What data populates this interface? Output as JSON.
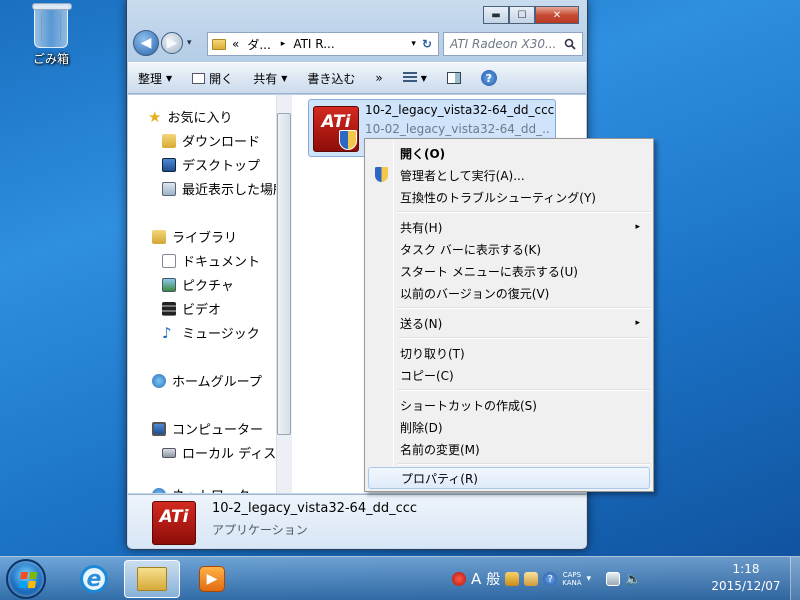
{
  "desktop": {
    "recycle_bin_label": "ごみ箱"
  },
  "window": {
    "title_buttons": {
      "minimize": "▬",
      "maximize": "☐",
      "close": "✕"
    },
    "breadcrumb": {
      "chevrons": "«",
      "segment1": "ダ...",
      "separator": "▸",
      "segment2": "ATI R...",
      "dropdown": "▾",
      "refresh": "↻"
    },
    "search_placeholder": "ATI Radeon X30...",
    "back_glyph": "◀",
    "forward_glyph": "▶",
    "toolbar": {
      "organize": "整理",
      "open": "開く",
      "share": "共有",
      "burn": "書き込む",
      "more": "»"
    },
    "nav": {
      "favorites": "お気に入り",
      "downloads": "ダウンロード",
      "desktop": "デスクトップ",
      "recent": "最近表示した場所",
      "libraries": "ライブラリ",
      "documents": "ドキュメント",
      "pictures": "ピクチャ",
      "videos": "ビデオ",
      "music": "ミュージック",
      "homegroup": "ホームグループ",
      "computer": "コンピューター",
      "local_disk": "ローカル ディスク",
      "network_partial": "ネットワーク"
    },
    "file": {
      "name": "10-2_legacy_vista32-64_dd_ccc",
      "description": "10-02_legacy_vista32-64_dd_...",
      "logo_text": "ATi"
    },
    "details": {
      "name": "10-2_legacy_vista32-64_dd_ccc",
      "type": "アプリケーション"
    }
  },
  "context_menu": {
    "items": [
      {
        "label": "開く(O)"
      },
      {
        "label": "管理者として実行(A)..."
      },
      {
        "label": "互換性のトラブルシューティング(Y)"
      },
      {
        "label": "共有(H)"
      },
      {
        "label": "タスク バーに表示する(K)"
      },
      {
        "label": "スタート メニューに表示する(U)"
      },
      {
        "label": "以前のバージョンの復元(V)"
      },
      {
        "label": "送る(N)"
      },
      {
        "label": "切り取り(T)"
      },
      {
        "label": "コピー(C)"
      },
      {
        "label": "ショートカットの作成(S)"
      },
      {
        "label": "削除(D)"
      },
      {
        "label": "名前の変更(M)"
      },
      {
        "label": "プロパティ(R)"
      }
    ],
    "submenu_arrow": "▸"
  },
  "taskbar": {
    "ime_mode": "A",
    "ime_kana": "般",
    "caps": "CAPS",
    "kana": "KANA",
    "time": "1:18",
    "date": "2015/12/07"
  },
  "colors": {
    "selection": "#cfe3fb",
    "menu_highlight": "#dfeafa",
    "ati_red": "#c8201a"
  },
  "icons": [
    "recycle-bin-icon",
    "back-icon",
    "forward-icon",
    "folder-icon",
    "search-icon",
    "star-icon",
    "download-icon",
    "desktop-icon",
    "recent-icon",
    "library-icon",
    "document-icon",
    "picture-icon",
    "video-icon",
    "music-icon",
    "homegroup-icon",
    "computer-icon",
    "disk-icon",
    "shield-icon",
    "windows-flag-icon",
    "ie-icon",
    "explorer-icon",
    "media-player-icon",
    "volume-icon",
    "network-icon"
  ]
}
